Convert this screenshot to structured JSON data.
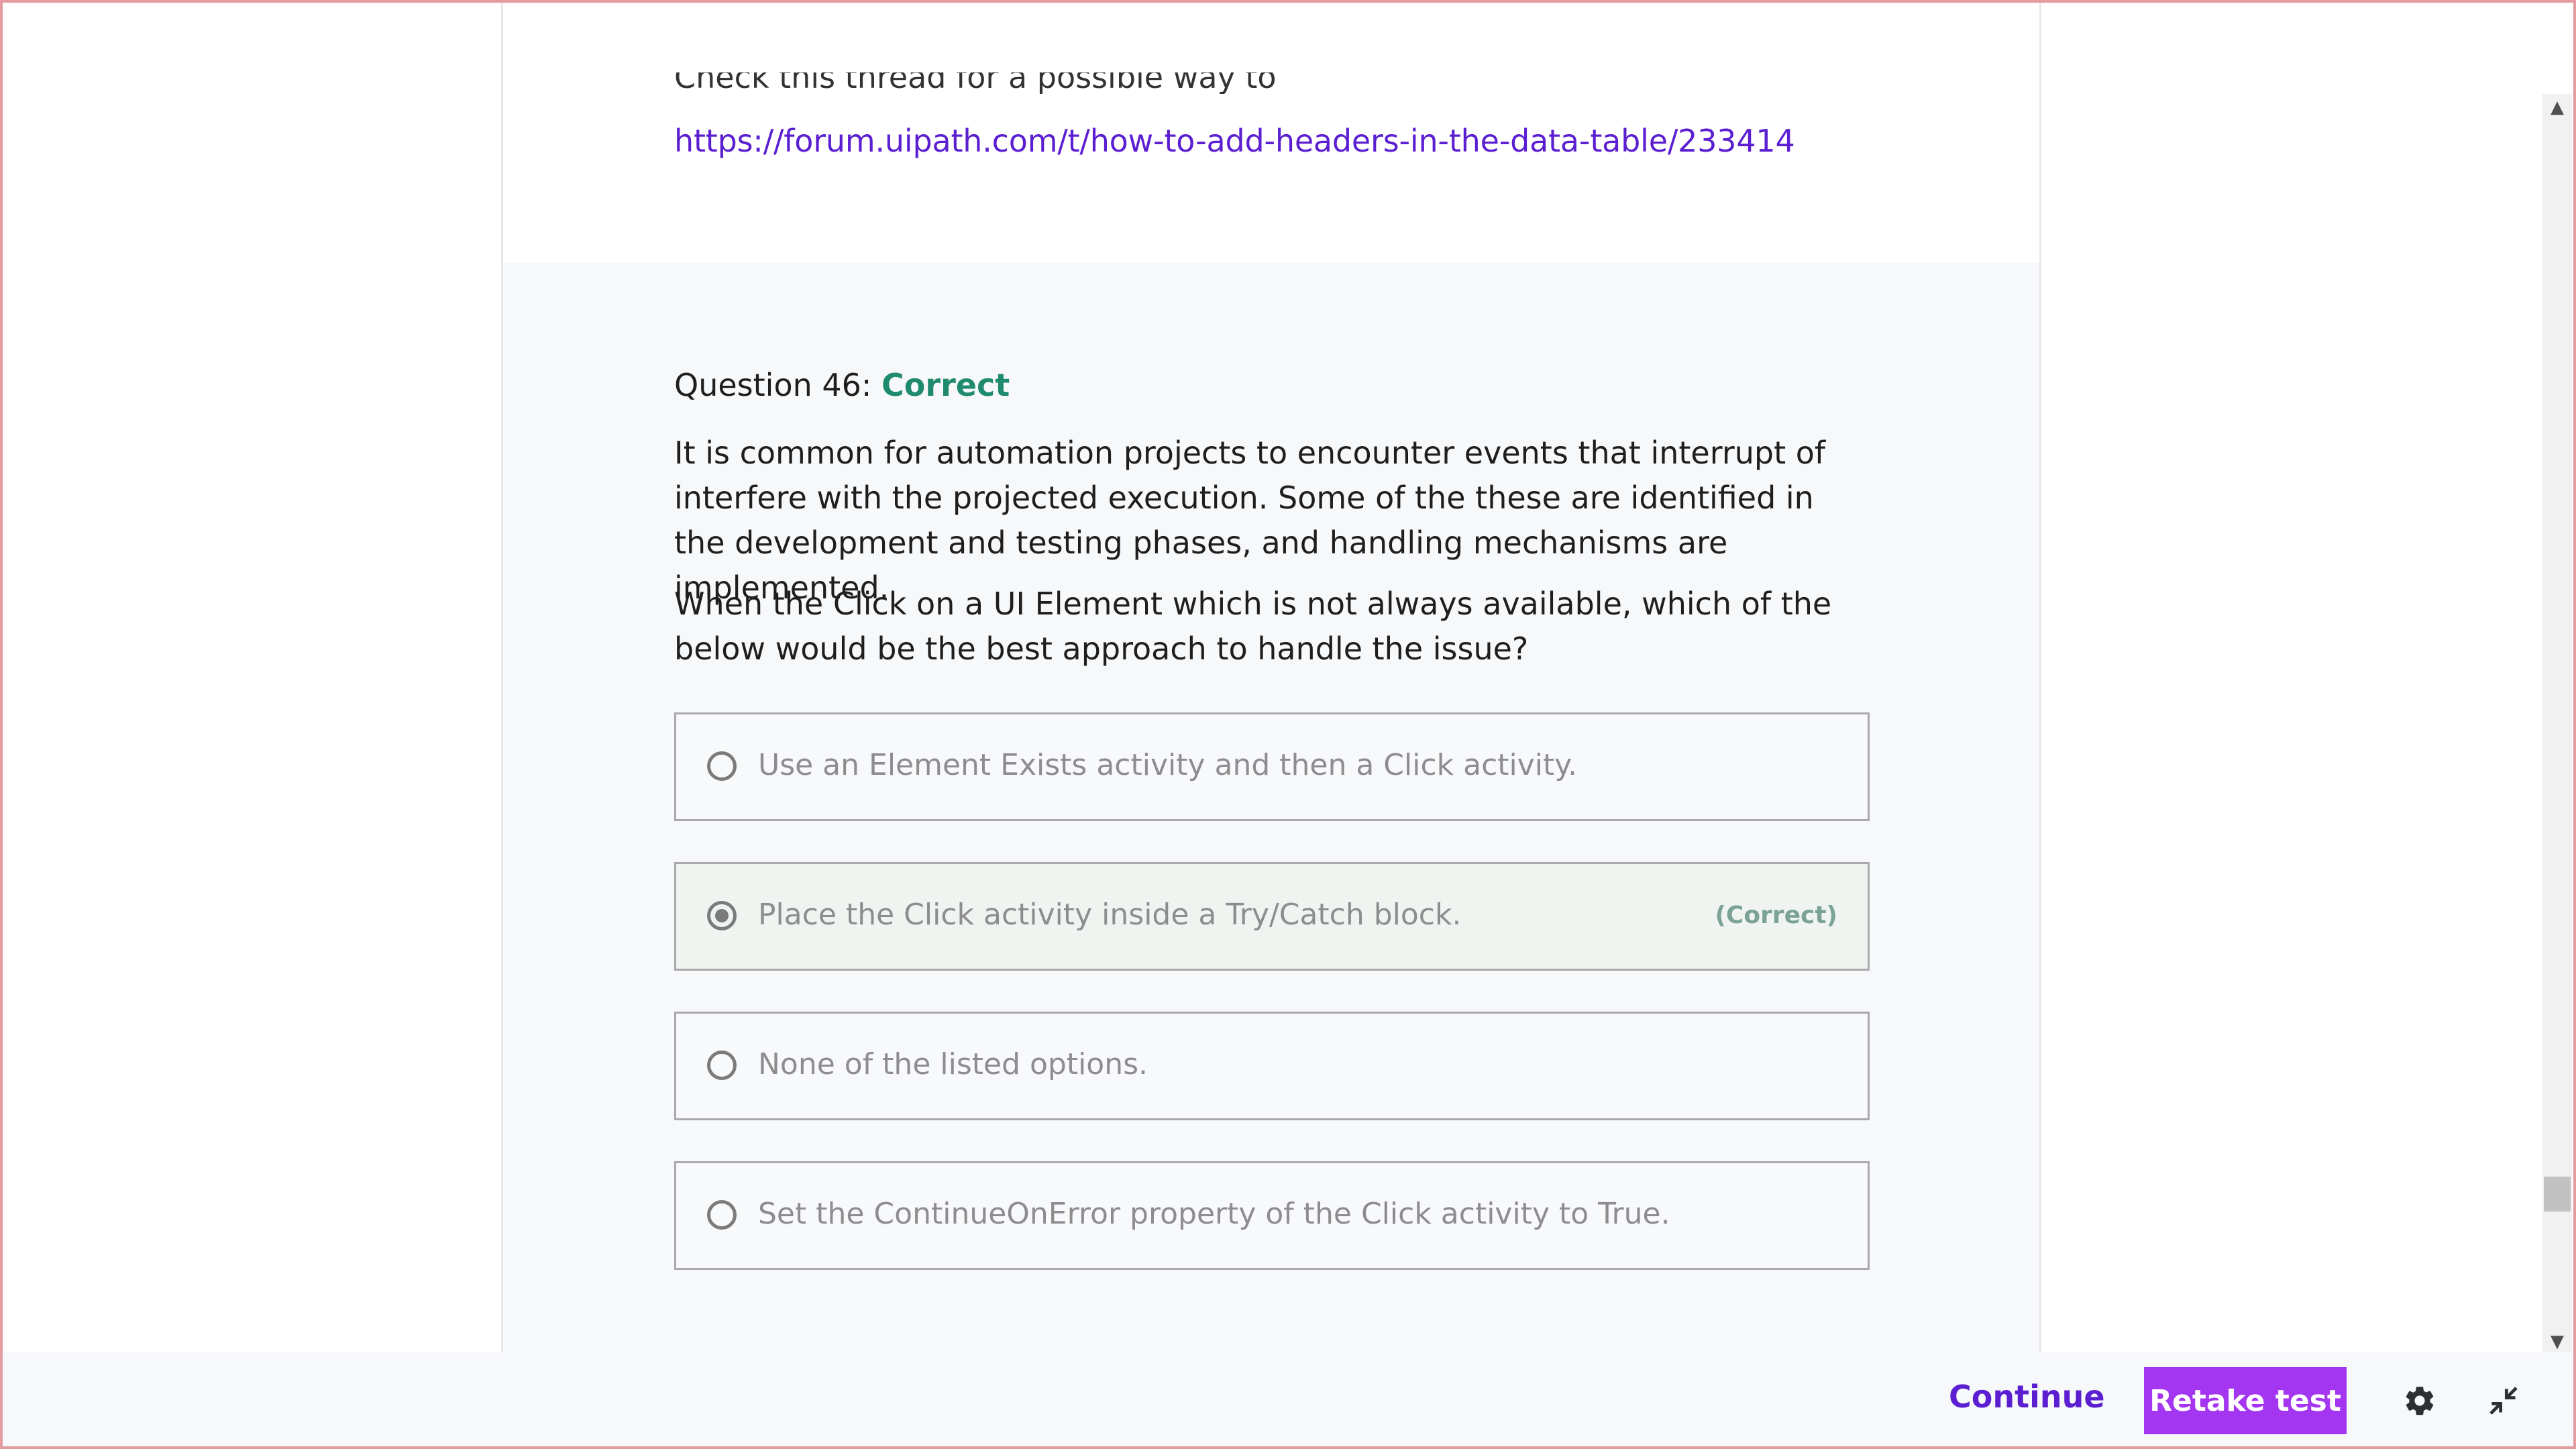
{
  "previous_answer": {
    "partial_text": "Check this thread for a possible way to resolve this",
    "link": "https://forum.uipath.com/t/how-to-add-headers-in-the-data-table/233414"
  },
  "question": {
    "label": "Question 46:",
    "status": "Correct",
    "paragraph1": "It is common for automation projects to encounter events that interrupt of interfere with the projected execution. Some of the these are identified in the development and testing phases, and handling mechanisms are implemented.",
    "paragraph2": "When the Click on a UI Element which is not always available, which of the below would be the best approach to handle the issue?",
    "options": [
      {
        "label": "Use an Element Exists activity and then a Click activity.",
        "selected": false,
        "tag": ""
      },
      {
        "label": "Place the Click activity inside a Try/Catch block.",
        "selected": true,
        "tag": "(Correct)"
      },
      {
        "label": "None of the listed options.",
        "selected": false,
        "tag": ""
      },
      {
        "label": "Set the ContinueOnError property of the Click activity to True.",
        "selected": false,
        "tag": ""
      }
    ]
  },
  "footer": {
    "continue_label": "Continue",
    "retake_label": "Retake test"
  },
  "icons": {
    "settings": "gear-icon",
    "collapse": "collapse-arrows-icon",
    "scroll_up": "triangle-up-icon",
    "scroll_down": "triangle-down-icon"
  },
  "colors": {
    "accent_purple": "#a435f0",
    "link_purple": "#5b1fd1",
    "correct_green": "#1f8a6e"
  }
}
